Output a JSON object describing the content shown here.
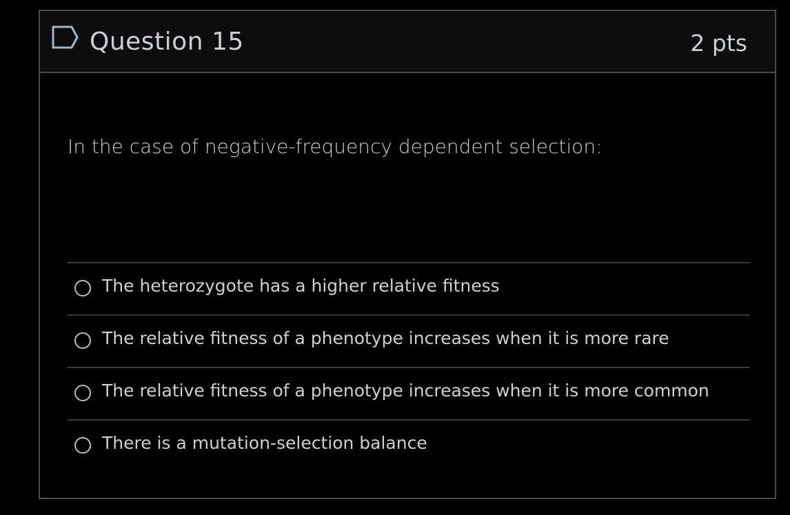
{
  "question": {
    "title": "Question 15",
    "points": "2 pts",
    "prompt": "In the case of negative-frequency dependent selection:",
    "flag_icon": "flag-outline-icon"
  },
  "answers": [
    {
      "label": "The heterozygote has a higher relative fitness",
      "selected": false
    },
    {
      "label": "The relative fitness of a phenotype increases when it is more rare",
      "selected": false
    },
    {
      "label": "The relative fitness of a phenotype increases when it is more common",
      "selected": false
    },
    {
      "label": "There is a mutation-selection balance",
      "selected": false
    }
  ],
  "colors": {
    "background": "#000000",
    "header_background": "#0d0d0d",
    "border": "#4a4a4a",
    "text": "#cfcfcf",
    "flag": "#9fb8d0"
  }
}
